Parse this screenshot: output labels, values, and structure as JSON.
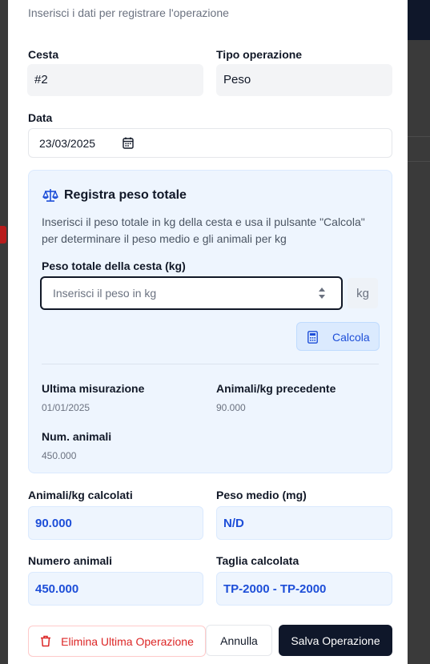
{
  "dialog": {
    "subtitle": "Inserisci i dati per registrare l'operazione"
  },
  "form": {
    "basket_label": "Cesta",
    "basket_value": "#2",
    "operation_type_label": "Tipo operazione",
    "operation_type_value": "Peso",
    "date_label": "Data",
    "date_value": "23/03/2025"
  },
  "weigh_panel": {
    "title": "Registra peso totale",
    "description": "Inserisci il peso totale in kg della cesta e usa il pulsante \"Calcola\" per determinare il peso medio e gli animali per kg",
    "weight_label": "Peso totale della cesta (kg)",
    "weight_placeholder": "Inserisci il peso in kg",
    "weight_value": "",
    "unit": "kg",
    "calc_button": "Calcola",
    "last_measurement_label": "Ultima misurazione",
    "last_measurement_value": "01/01/2025",
    "prev_animals_kg_label": "Animali/kg precedente",
    "prev_animals_kg_value": "90.000",
    "num_animals_label": "Num. animali",
    "num_animals_value": "450.000"
  },
  "results": {
    "animals_kg_label": "Animali/kg calcolati",
    "animals_kg_value": "90.000",
    "avg_weight_label": "Peso medio (mg)",
    "avg_weight_value": "N/D",
    "animal_count_label": "Numero animali",
    "animal_count_value": "450.000",
    "size_label": "Taglia calcolata",
    "size_value": "TP-2000 - TP-2000"
  },
  "actions": {
    "delete_label": "Elimina Ultima Operazione",
    "cancel_label": "Annulla",
    "save_label": "Salva Operazione"
  },
  "colors": {
    "accent": "#1d4ed8",
    "danger": "#dc2626",
    "primary_button": "#0f172a",
    "panel_background": "#eef5fe"
  },
  "icons": [
    "calendar-icon",
    "scale-icon",
    "spinner-icon",
    "calculator-icon",
    "trash-icon"
  ]
}
